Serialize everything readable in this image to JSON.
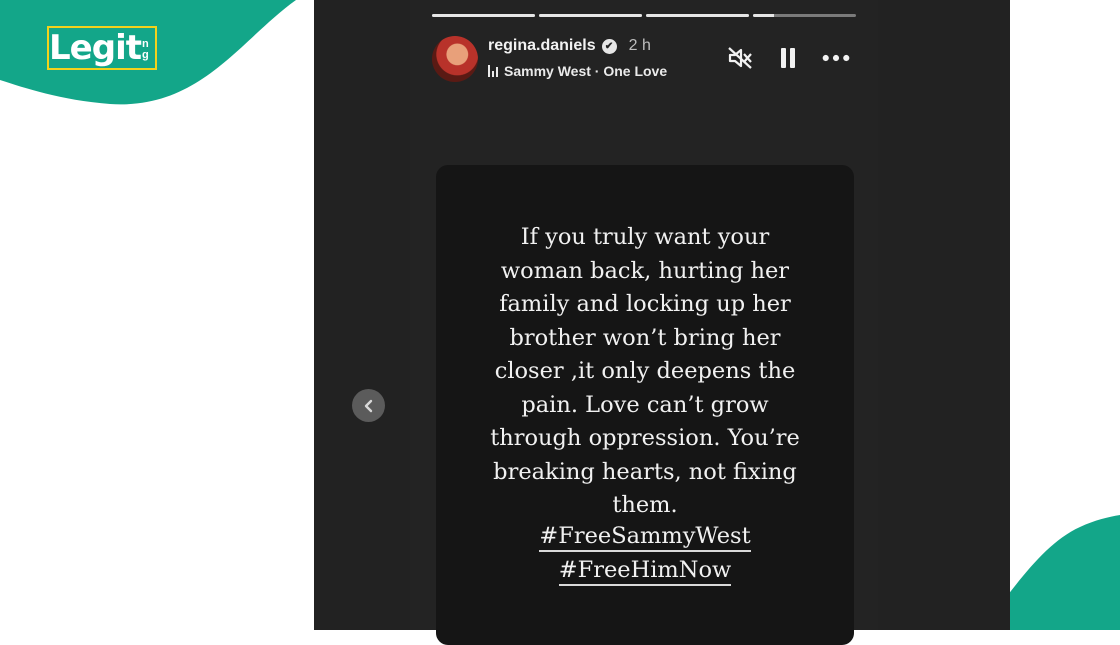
{
  "brand": {
    "logo_text": "Legit",
    "logo_tld_top": "n",
    "logo_tld_bottom": "g",
    "accent_color": "#13a689",
    "logo_border_color": "#f2d21b"
  },
  "story": {
    "progress": [
      1.0,
      1.0,
      1.0,
      0.2
    ],
    "username": "regina.daniels",
    "verified": true,
    "time": "2 h",
    "music": "Sammy West · One Love",
    "controls": [
      "mute-icon",
      "pause-icon",
      "more-icon"
    ],
    "text": "If you truly want your\nwoman back, hurting her\nfamily and locking up her\nbrother won’t bring her\ncloser ,it only deepens the\npain. Love can’t grow\nthrough oppression. You’re\nbreaking hearts, not fixing\nthem.",
    "hashtags": [
      "#FreeSammyWest",
      "#FreeHimNow"
    ]
  }
}
